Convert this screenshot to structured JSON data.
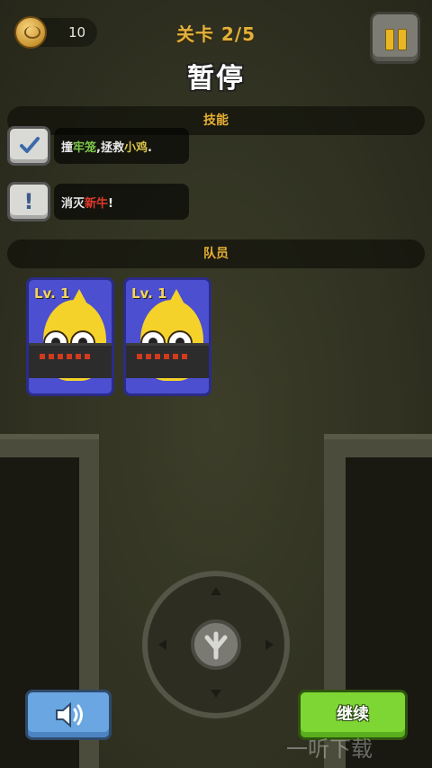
{
  "hud": {
    "coins": "10",
    "level_label": "关卡 2/5"
  },
  "pause_menu": {
    "title": "暂停",
    "skills_header": "技能",
    "team_header": "队员",
    "continue_label": "继续"
  },
  "objectives": [
    {
      "status": "complete",
      "icon": "check-icon",
      "parts": [
        {
          "text": "撞",
          "color": "#e8e8e8"
        },
        {
          "text": "牢笼",
          "color": "#7ec84a"
        },
        {
          "text": ",拯救",
          "color": "#e8e8e8"
        },
        {
          "text": "小鸡",
          "color": "#d9c34a"
        },
        {
          "text": ".",
          "color": "#e8e8e8"
        }
      ]
    },
    {
      "status": "pending",
      "icon": "exclamation-icon",
      "parts": [
        {
          "text": "消灭",
          "color": "#e8e8e8"
        },
        {
          "text": "新牛",
          "color": "#e0392b"
        },
        {
          "text": "!",
          "color": "#e8e8e8"
        }
      ]
    }
  ],
  "team": [
    {
      "level_label": "Lv. 1",
      "icon": "chick-gunner-icon"
    },
    {
      "level_label": "Lv. 1",
      "icon": "chick-gunner-icon"
    }
  ],
  "watermark": "一听下载",
  "colors": {
    "accent_gold": "#e6ae34",
    "continue_green": "#7ed634",
    "sound_blue": "#6aa6e2",
    "card_blue": "#4b4fd0"
  }
}
